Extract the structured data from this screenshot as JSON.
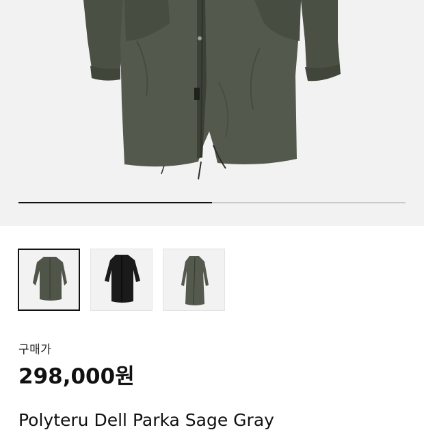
{
  "product": {
    "purchase_price_label": "구매가",
    "price": "298,000원",
    "title": "Polyteru Dell Parka Sage Gray"
  },
  "gallery": {
    "progress_fraction": 0.5,
    "thumbnails": [
      {
        "color": "sage-gray parka",
        "selected": true
      },
      {
        "color": "black parka",
        "selected": false
      },
      {
        "color": "sage-gray parka folded",
        "selected": false
      }
    ]
  },
  "colors": {
    "sage": "#4e5448",
    "black": "#1a1a1a",
    "background": "#f2f2f2"
  }
}
